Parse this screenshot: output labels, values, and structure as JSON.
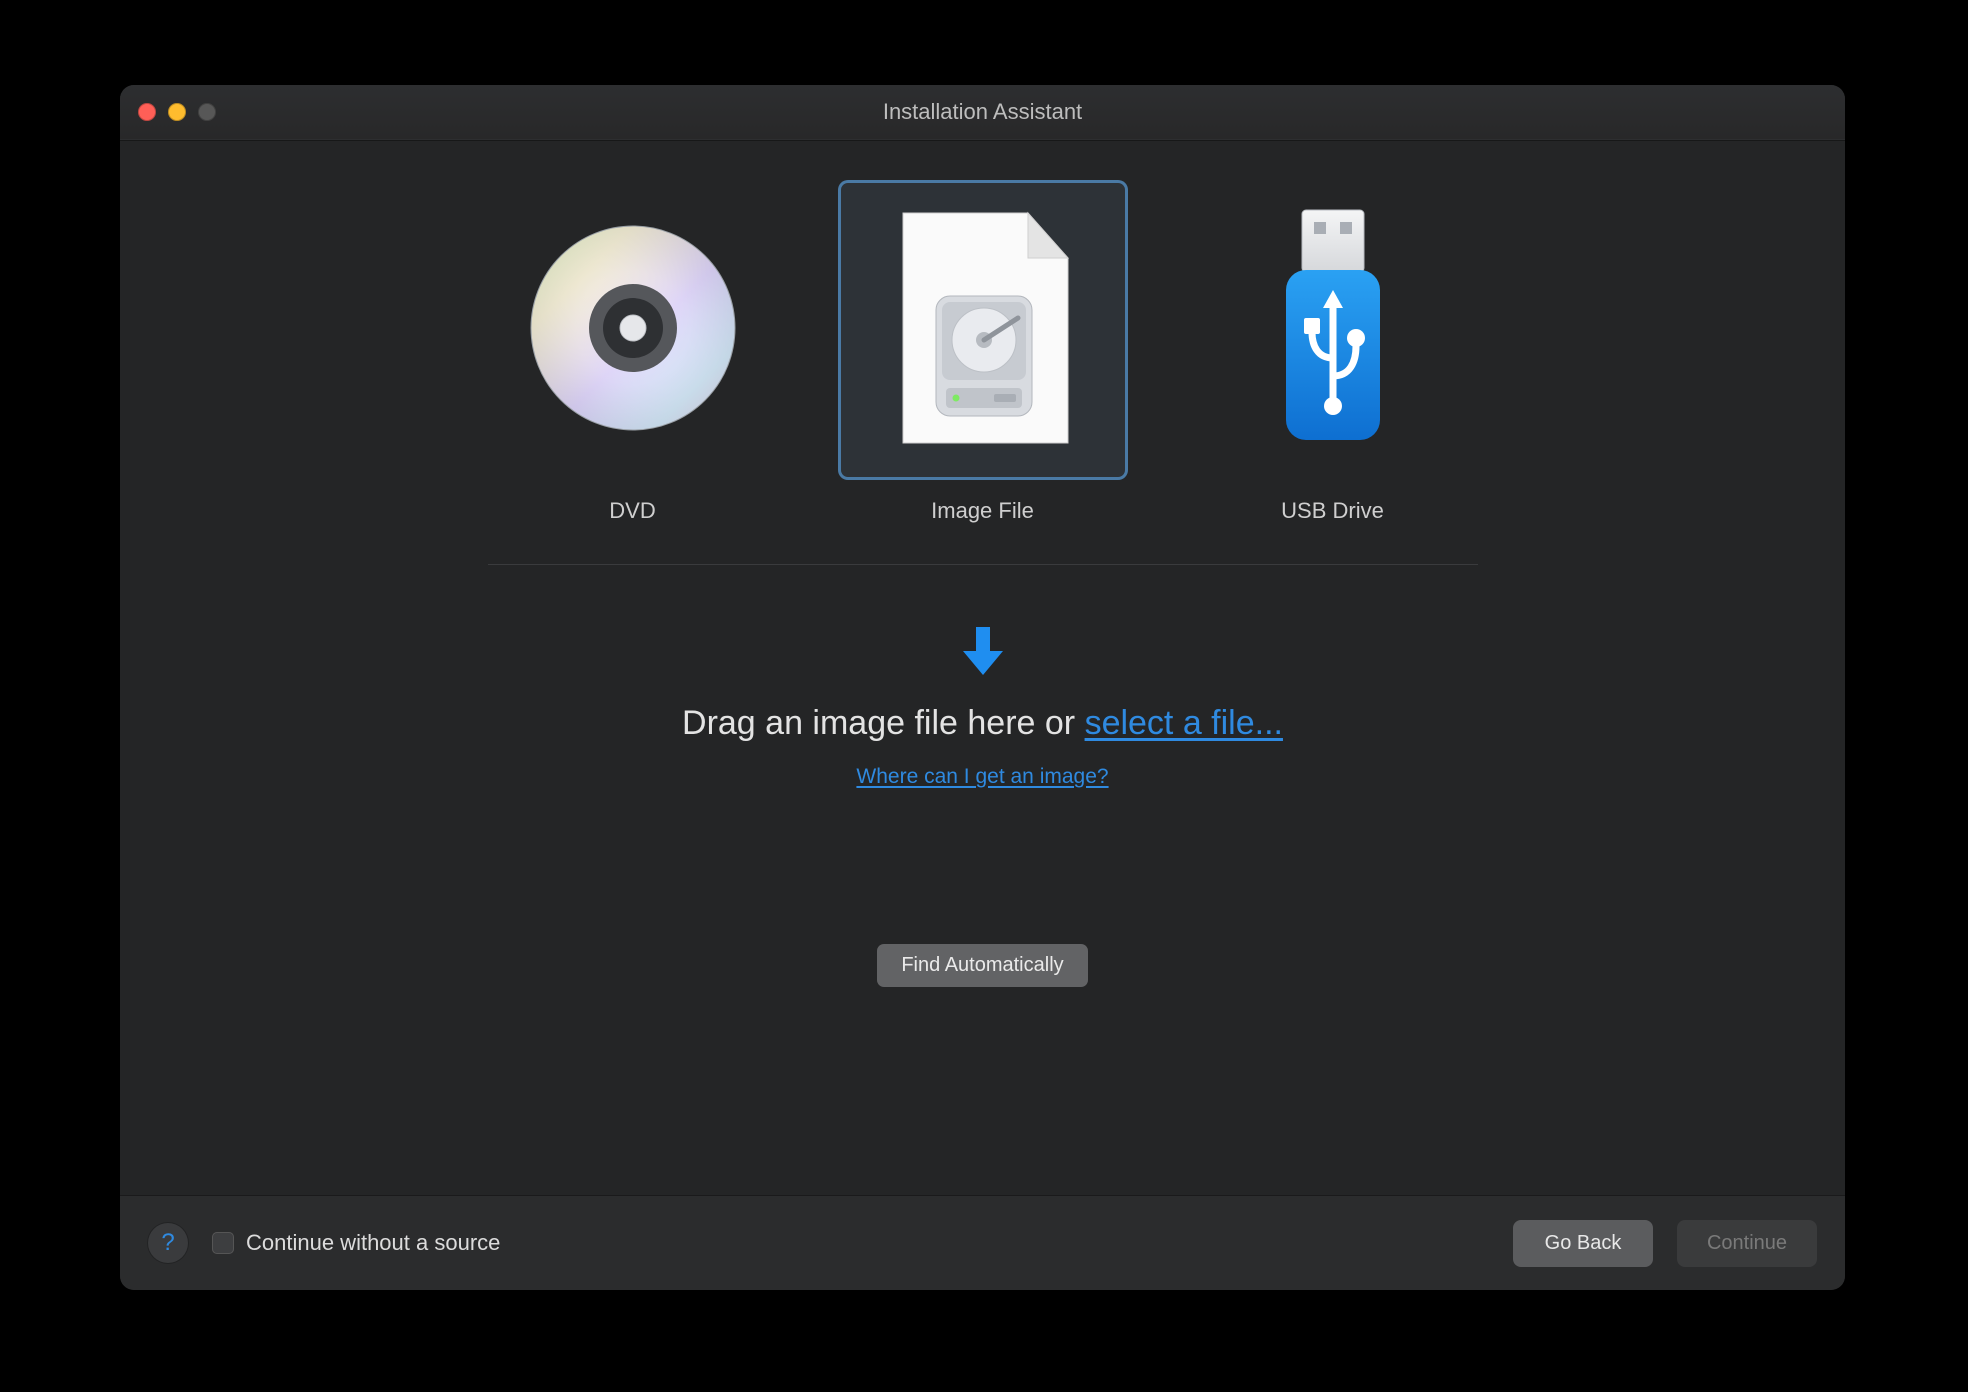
{
  "window": {
    "title": "Installation Assistant"
  },
  "sources": {
    "dvd": {
      "label": "DVD",
      "selected": false
    },
    "image": {
      "label": "Image File",
      "selected": true
    },
    "usb": {
      "label": "USB Drive",
      "selected": false
    }
  },
  "drop": {
    "prompt_prefix": "Drag an image file here or ",
    "select_link": "select a file...",
    "help_link": "Where can I get an image?"
  },
  "buttons": {
    "find_auto": "Find Automatically",
    "go_back": "Go Back",
    "continue": "Continue"
  },
  "footer": {
    "continue_without_source": "Continue without a source",
    "continue_enabled": false
  },
  "colors": {
    "accent_link": "#2f8ae0",
    "selection_border": "#4a7aa5"
  }
}
